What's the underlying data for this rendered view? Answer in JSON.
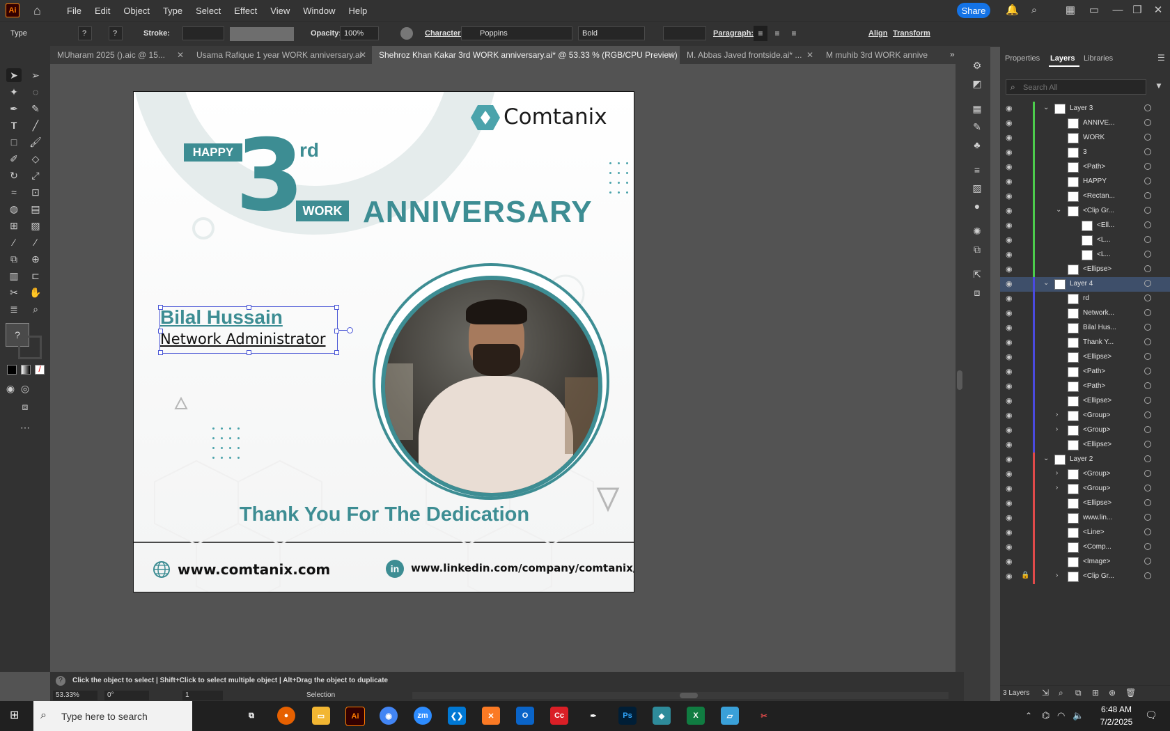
{
  "app": {
    "logo": "Ai",
    "menu": [
      "File",
      "Edit",
      "Object",
      "Type",
      "Select",
      "Effect",
      "View",
      "Window",
      "Help"
    ],
    "share_label": "Share"
  },
  "control_bar": {
    "tool_name": "Type",
    "stroke_label": "Stroke:",
    "opacity_label": "Opacity:",
    "opacity_value": "100%",
    "character_label": "Character:",
    "font_family": "Poppins",
    "font_style": "Bold",
    "paragraph_label": "Paragraph:",
    "align_label": "Align",
    "transform_label": "Transform"
  },
  "tabs": [
    {
      "label": "MUharam 2025 ().aic @ 15..."
    },
    {
      "label": "Usama Rafique 1 year WORK anniversary.ai"
    },
    {
      "label": "Shehroz Khan Kakar   3rd  WORK anniversary.ai* @ 53.33 % (RGB/CPU Preview)"
    },
    {
      "label": "M. Abbas Javed   frontside.ai* ..."
    },
    {
      "label": "M muhib 3rd  WORK annive"
    }
  ],
  "artwork": {
    "brand": "Comtanix",
    "happy": "HAPPY",
    "number": "3",
    "suffix": "rd",
    "work": "WORK",
    "anniversary": "ANNIVERSARY",
    "name": "Bilal Hussain",
    "role": "Network Administrator",
    "thanks": "Thank You For The Dedication",
    "website": "www.comtanix.com",
    "linkedin": "www.linkedin.com/company/comtanix/",
    "linkedin_icon": "in",
    "teal": "#3d8d93"
  },
  "panel": {
    "tabs": [
      "Properties",
      "Layers",
      "Libraries"
    ],
    "search_placeholder": "Search All",
    "layers": [
      {
        "name": "Layer 3",
        "color": "#4ccc4c"
      },
      {
        "name": "ANNIVE...",
        "color": "#4ccc4c"
      },
      {
        "name": "WORK",
        "color": "#4ccc4c"
      },
      {
        "name": "3",
        "color": "#4ccc4c"
      },
      {
        "name": "<Path>",
        "color": "#4ccc4c"
      },
      {
        "name": "HAPPY",
        "color": "#4ccc4c"
      },
      {
        "name": "<Rectan...",
        "color": "#4ccc4c"
      },
      {
        "name": "<Clip Gr...",
        "color": "#4ccc4c"
      },
      {
        "name": "<Ell...",
        "color": "#4ccc4c"
      },
      {
        "name": "<L...",
        "color": "#4ccc4c"
      },
      {
        "name": "<L...",
        "color": "#4ccc4c"
      },
      {
        "name": "<Ellipse>",
        "color": "#4ccc4c"
      },
      {
        "name": "Layer 4",
        "color": "#4a4adf"
      },
      {
        "name": "rd",
        "color": "#4a4adf"
      },
      {
        "name": "Network...",
        "color": "#4a4adf"
      },
      {
        "name": "Bilal Hus...",
        "color": "#4a4adf"
      },
      {
        "name": "Thank Y...",
        "color": "#4a4adf"
      },
      {
        "name": "<Ellipse>",
        "color": "#4a4adf"
      },
      {
        "name": "<Path>",
        "color": "#4a4adf"
      },
      {
        "name": "<Path>",
        "color": "#4a4adf"
      },
      {
        "name": "<Ellipse>",
        "color": "#4a4adf"
      },
      {
        "name": "<Group>",
        "color": "#4a4adf"
      },
      {
        "name": "<Group>",
        "color": "#4a4adf"
      },
      {
        "name": "<Ellipse>",
        "color": "#4a4adf"
      },
      {
        "name": "Layer 2",
        "color": "#e04a4a"
      },
      {
        "name": "<Group>",
        "color": "#e04a4a"
      },
      {
        "name": "<Group>",
        "color": "#e04a4a"
      },
      {
        "name": "<Ellipse>",
        "color": "#e04a4a"
      },
      {
        "name": "www.lin...",
        "color": "#e04a4a"
      },
      {
        "name": "<Line>",
        "color": "#e04a4a"
      },
      {
        "name": "<Comp...",
        "color": "#e04a4a"
      },
      {
        "name": "<Image>",
        "color": "#e04a4a"
      },
      {
        "name": "<Clip Gr...",
        "color": "#e04a4a"
      }
    ],
    "footer": "3 Layers"
  },
  "status": {
    "hint": "Click the object to select  |  Shift+Click to select multiple object  |  Alt+Drag the object to duplicate",
    "zoom": "53.33%",
    "rotation": "0°",
    "artboard_num": "1",
    "mode": "Selection"
  },
  "taskbar": {
    "search_placeholder": "Type here to search",
    "time": "6:48 AM",
    "date": "7/2/2025"
  }
}
